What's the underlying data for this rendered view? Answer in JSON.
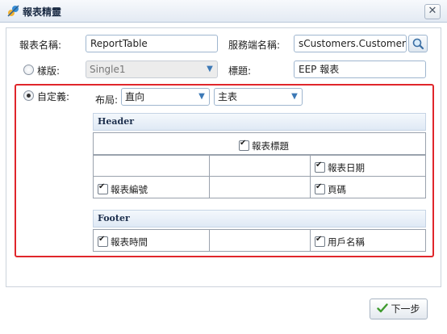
{
  "window": {
    "title": "報表精靈",
    "close_glyph": "✕"
  },
  "form": {
    "report_name_label": "報表名稱:",
    "report_name_value": "ReportTable",
    "server_name_label": "服務端名稱:",
    "server_name_value": "sCustomers.Customers",
    "template_label": "樣版:",
    "template_value": "Single1",
    "heading_label": "標題:",
    "heading_value": "EEP 報表",
    "custom_label": "自定義:",
    "layout_label": "布局:",
    "layout_value": "直向",
    "table_value": "主表"
  },
  "header_section": {
    "title": "Header",
    "report_title_check": "報表標題",
    "report_date_check": "報表日期",
    "report_number_check": "報表編號",
    "page_number_check": "頁碼"
  },
  "footer_section": {
    "title": "Footer",
    "report_time_check": "報表時間",
    "user_name_check": "用戶名稱"
  },
  "buttons": {
    "next_label": "下一步"
  }
}
